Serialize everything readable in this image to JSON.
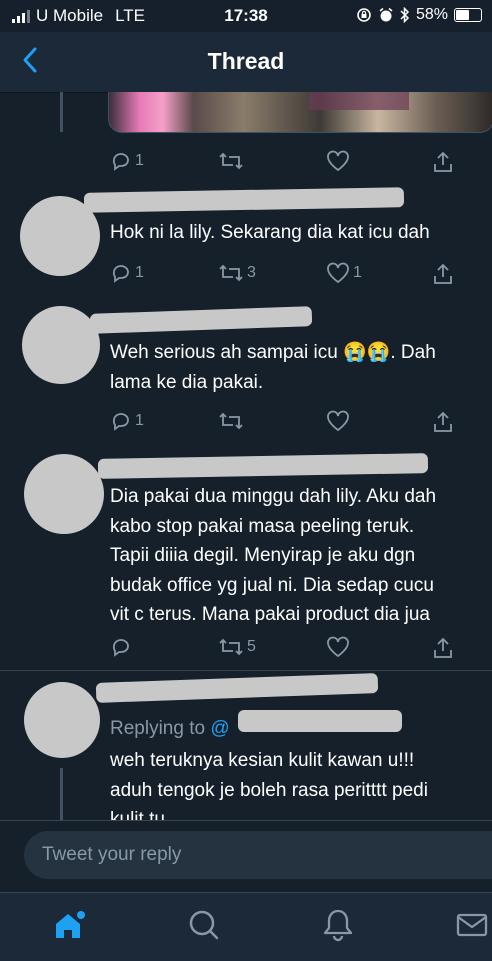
{
  "status_bar": {
    "carrier": "U Mobile",
    "network": "LTE",
    "time": "17:38",
    "battery": "58%"
  },
  "header": {
    "title": "Thread",
    "back_icon": "chevron-left-icon"
  },
  "tweets": [
    {
      "text_lines": [],
      "replies": "1",
      "retweets": "",
      "likes": ""
    },
    {
      "text_lines": [
        "Hok ni la lily. Sekarang dia kat icu dah"
      ],
      "replies": "1",
      "retweets": "3",
      "likes": "1"
    },
    {
      "text_lines": [
        "Weh serious ah sampai icu 😭😭. Dah",
        "lama ke dia pakai."
      ],
      "replies": "1",
      "retweets": "",
      "likes": ""
    },
    {
      "text_lines": [
        "Dia pakai dua minggu dah lily. Aku dah",
        "kabo stop pakai masa peeling teruk.",
        "Tapii diiia degil. Menyirap je aku dgn",
        "budak office yg jual ni. Dia sedap cucu",
        "vit c terus. Mana pakai product dia jua"
      ],
      "replies": "",
      "retweets": "5",
      "likes": ""
    },
    {
      "replying_to_label": "Replying to",
      "replying_handle": "@",
      "text_lines": [
        "weh teruknya kesian kulit kawan u!!!",
        "aduh tengok je boleh rasa peritttt pedi",
        "kulit tu"
      ]
    }
  ],
  "composer": {
    "placeholder": "Tweet your reply"
  },
  "tabs": [
    {
      "name": "home-icon",
      "active": true
    },
    {
      "name": "search-icon",
      "active": false
    },
    {
      "name": "notifications-icon",
      "active": false
    },
    {
      "name": "messages-icon",
      "active": false
    }
  ],
  "colors": {
    "background": "#15202b",
    "accent": "#1da1f2",
    "muted": "#8899a6"
  }
}
